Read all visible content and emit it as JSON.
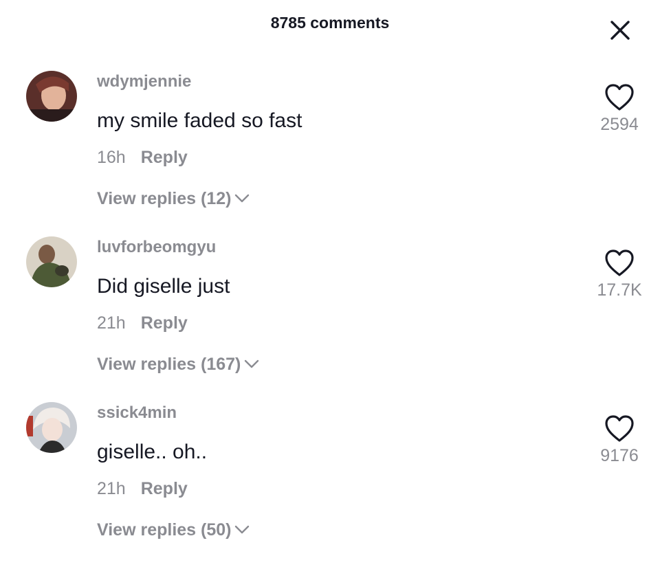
{
  "header": {
    "title": "8785 comments",
    "close_icon": "close-icon"
  },
  "comments": [
    {
      "username": "wdymjennie",
      "text": "my smile faded so fast",
      "time": "16h",
      "reply_label": "Reply",
      "view_replies": "View replies (12)",
      "likes": "2594",
      "avatar_colors": [
        "#5a2f2a",
        "#e2b39a",
        "#2a1c1c"
      ]
    },
    {
      "username": "luvforbeomgyu",
      "text": "Did giselle just",
      "time": "21h",
      "reply_label": "Reply",
      "view_replies": "View replies (167)",
      "likes": "17.7K",
      "avatar_colors": [
        "#d9d2c5",
        "#4d5a36",
        "#3a3a2c"
      ]
    },
    {
      "username": "ssick4min",
      "text": "giselle.. oh..",
      "time": "21h",
      "reply_label": "Reply",
      "view_replies": "View replies (50)",
      "likes": "9176",
      "avatar_colors": [
        "#c9cdd3",
        "#f1ece8",
        "#b23a2e"
      ]
    }
  ],
  "colors": {
    "primary_text": "#161823",
    "secondary_text": "#8a8b91",
    "background": "#ffffff"
  }
}
